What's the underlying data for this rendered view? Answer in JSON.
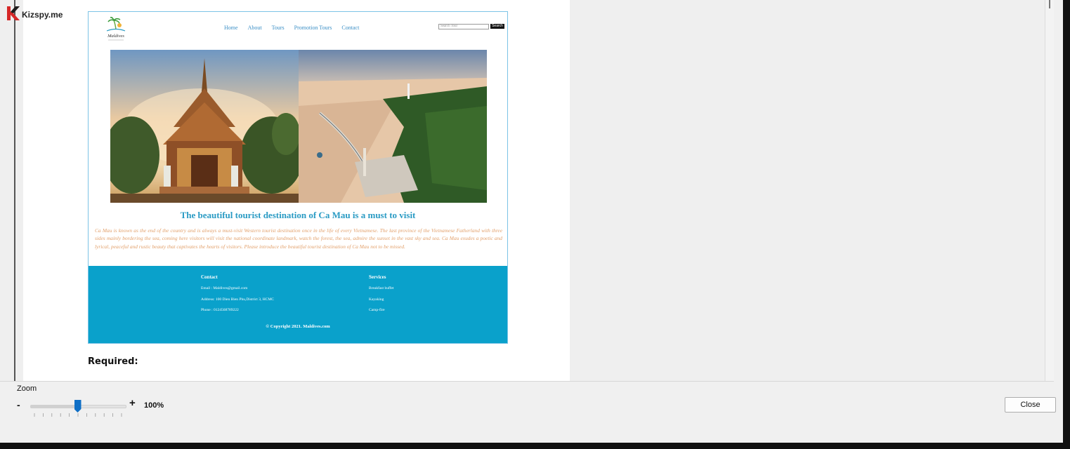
{
  "watermark": {
    "brand": "Kizspy.me"
  },
  "site": {
    "logo_text": "Maldives",
    "nav": [
      "Home",
      "About",
      "Tours",
      "Promotion Tours",
      "Contact"
    ],
    "search": {
      "placeholder": "Search Tour",
      "button": "Search"
    },
    "title": "The beautiful tourist destination of Ca Mau is a must to visit",
    "paragraph": "Ca Mau is known as the end of the country and is always a must-visit Western tourist destination once in the life of every Vietnamese. The last province of the Vietnamese Fatherland with three sides mainly bordering the sea, coming here visitors will visit the national coordinate landmark, watch the forest, the sea, admire the sunset in the vast sky and sea. Ca Mau exudes a poetic and lyrical, peaceful and rustic beauty that captivates the hearts of visitors. Please introduce the beautiful tourist destination of Ca Mau not to be missed.",
    "footer": {
      "contact": {
        "heading": "Contact",
        "email": "Email : Maldives@gmail.com",
        "address": "Address: 100 Dien Bien Phu,District 3, HCMC",
        "phone": "Phone : 0124568789222"
      },
      "services": {
        "heading": "Services",
        "items": [
          "Breakfast buffet",
          "Kayaking",
          "Camp-fire"
        ]
      },
      "copyright": "© Copyright 2021. Maldives.com"
    }
  },
  "document": {
    "required_label": "Required:"
  },
  "zoom": {
    "label": "Zoom",
    "minus": "-",
    "plus": "+",
    "value": "100%",
    "level_fraction": 0.5
  },
  "close_button": "Close",
  "colors": {
    "accent": "#0f6fc6",
    "footer_blue": "#0aa1cb",
    "title_blue": "#2a9bc4",
    "para_orange": "#e2a06b"
  }
}
